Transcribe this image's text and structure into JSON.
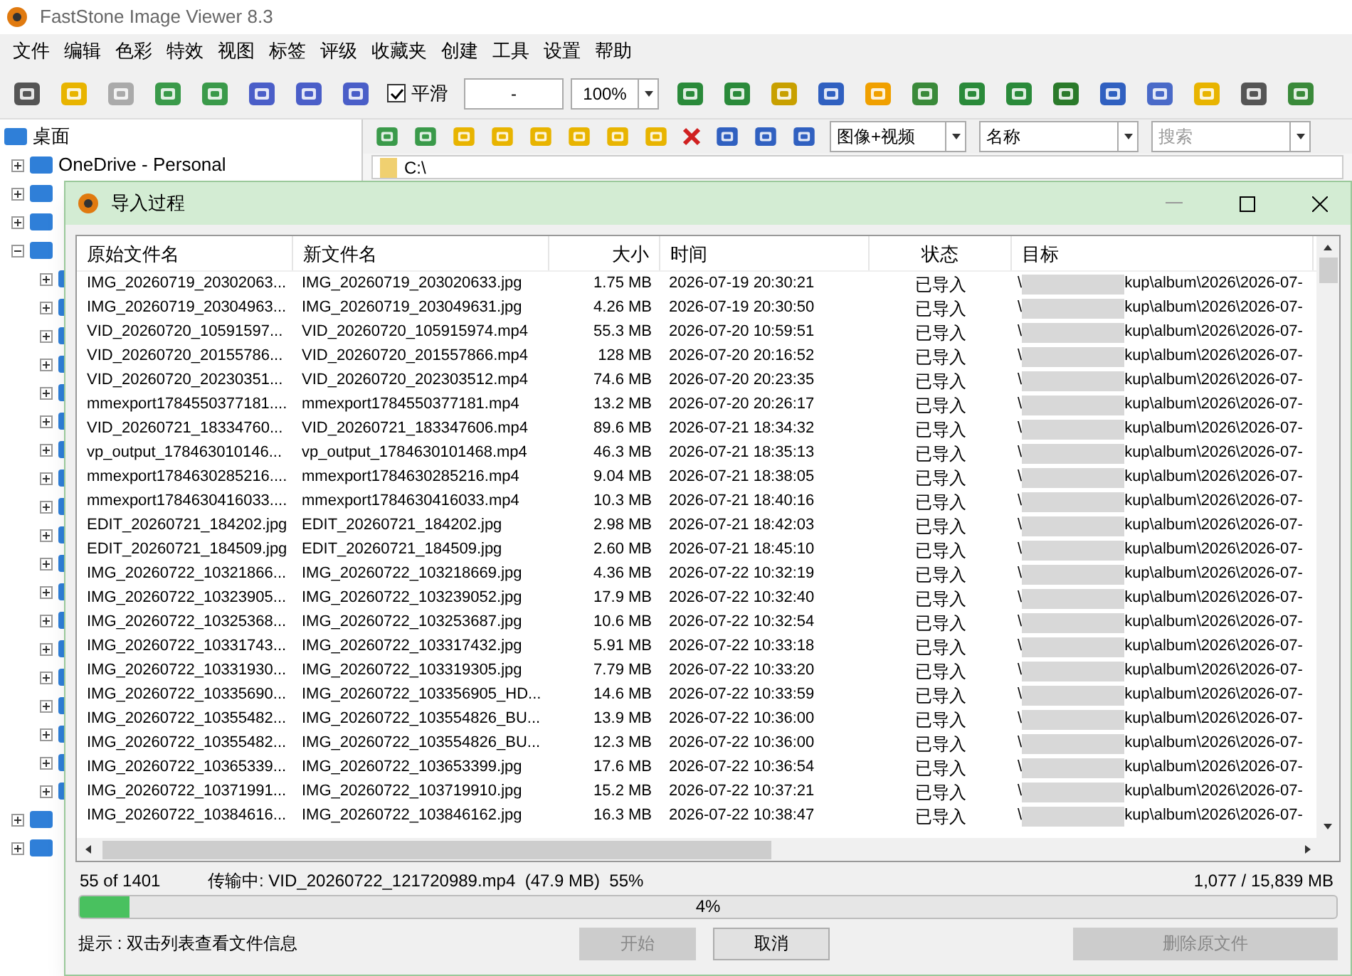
{
  "app_title": "FastStone Image Viewer 8.3",
  "menu": [
    "文件",
    "编辑",
    "色彩",
    "特效",
    "视图",
    "标签",
    "评级",
    "收藏夹",
    "创建",
    "工具",
    "设置",
    "帮助"
  ],
  "toolbar": {
    "smooth": {
      "label": "平滑",
      "checked": true
    },
    "size_field": {
      "value": "-"
    },
    "zoom": {
      "value": "100%"
    }
  },
  "tree": {
    "label": "桌面",
    "children": [
      {
        "label": "OneDrive - Personal",
        "expanded": false
      },
      {
        "expanded": false
      },
      {
        "expanded": false
      },
      {
        "expanded": true,
        "children": [
          {
            "expanded": false
          },
          {
            "expanded": false
          },
          {
            "expanded": false
          },
          {
            "expanded": false
          },
          {
            "expanded": false
          },
          {
            "expanded": false
          },
          {
            "expanded": false
          },
          {
            "expanded": false
          },
          {
            "expanded": false
          },
          {
            "expanded": false
          },
          {
            "expanded": false
          },
          {
            "expanded": false
          },
          {
            "expanded": false
          },
          {
            "expanded": false
          },
          {
            "expanded": false
          },
          {
            "expanded": false
          },
          {
            "expanded": false
          },
          {
            "expanded": false
          },
          {
            "expanded": false
          }
        ]
      },
      {
        "expanded": false
      },
      {
        "expanded": false
      }
    ]
  },
  "browser": {
    "filter": "图像+视频",
    "sort": "名称",
    "search": {
      "placeholder": "搜索"
    },
    "path": "C:\\"
  },
  "dialog": {
    "title": "导入过程",
    "columns": [
      "原始文件名",
      "新文件名",
      "大小",
      "时间",
      "状态",
      "目标"
    ],
    "rows": [
      {
        "original": "IMG_20260719_20302063...",
        "new": "IMG_20260719_203020633.jpg",
        "size": "1.75 MB",
        "time": "2026-07-19 20:30:21",
        "status": "已导入",
        "target_start": "\\",
        "target_end": "kup\\album\\2026\\2026-07-"
      },
      {
        "original": "IMG_20260719_20304963...",
        "new": "IMG_20260719_203049631.jpg",
        "size": "4.26 MB",
        "time": "2026-07-19 20:30:50",
        "status": "已导入",
        "target_start": "\\",
        "target_end": "kup\\album\\2026\\2026-07-"
      },
      {
        "original": "VID_20260720_10591597...",
        "new": "VID_20260720_105915974.mp4",
        "size": "55.3 MB",
        "time": "2026-07-20 10:59:51",
        "status": "已导入",
        "target_start": "\\",
        "target_end": "kup\\album\\2026\\2026-07-"
      },
      {
        "original": "VID_20260720_20155786...",
        "new": "VID_20260720_201557866.mp4",
        "size": "128 MB",
        "time": "2026-07-20 20:16:52",
        "status": "已导入",
        "target_start": "\\",
        "target_end": "kup\\album\\2026\\2026-07-"
      },
      {
        "original": "VID_20260720_20230351...",
        "new": "VID_20260720_202303512.mp4",
        "size": "74.6 MB",
        "time": "2026-07-20 20:23:35",
        "status": "已导入",
        "target_start": "\\",
        "target_end": "kup\\album\\2026\\2026-07-"
      },
      {
        "original": "mmexport1784550377181....",
        "new": "mmexport1784550377181.mp4",
        "size": "13.2 MB",
        "time": "2026-07-20 20:26:17",
        "status": "已导入",
        "target_start": "\\",
        "target_end": "kup\\album\\2026\\2026-07-"
      },
      {
        "original": "VID_20260721_18334760...",
        "new": "VID_20260721_183347606.mp4",
        "size": "89.6 MB",
        "time": "2026-07-21 18:34:32",
        "status": "已导入",
        "target_start": "\\",
        "target_end": "kup\\album\\2026\\2026-07-"
      },
      {
        "original": "vp_output_178463010146...",
        "new": "vp_output_1784630101468.mp4",
        "size": "46.3 MB",
        "time": "2026-07-21 18:35:13",
        "status": "已导入",
        "target_start": "\\",
        "target_end": "kup\\album\\2026\\2026-07-"
      },
      {
        "original": "mmexport1784630285216....",
        "new": "mmexport1784630285216.mp4",
        "size": "9.04 MB",
        "time": "2026-07-21 18:38:05",
        "status": "已导入",
        "target_start": "\\",
        "target_end": "kup\\album\\2026\\2026-07-"
      },
      {
        "original": "mmexport1784630416033....",
        "new": "mmexport1784630416033.mp4",
        "size": "10.3 MB",
        "time": "2026-07-21 18:40:16",
        "status": "已导入",
        "target_start": "\\",
        "target_end": "kup\\album\\2026\\2026-07-"
      },
      {
        "original": "EDIT_20260721_184202.jpg",
        "new": "EDIT_20260721_184202.jpg",
        "size": "2.98 MB",
        "time": "2026-07-21 18:42:03",
        "status": "已导入",
        "target_start": "\\",
        "target_end": "kup\\album\\2026\\2026-07-"
      },
      {
        "original": "EDIT_20260721_184509.jpg",
        "new": "EDIT_20260721_184509.jpg",
        "size": "2.60 MB",
        "time": "2026-07-21 18:45:10",
        "status": "已导入",
        "target_start": "\\",
        "target_end": "kup\\album\\2026\\2026-07-"
      },
      {
        "original": "IMG_20260722_10321866...",
        "new": "IMG_20260722_103218669.jpg",
        "size": "4.36 MB",
        "time": "2026-07-22 10:32:19",
        "status": "已导入",
        "target_start": "\\",
        "target_end": "kup\\album\\2026\\2026-07-"
      },
      {
        "original": "IMG_20260722_10323905...",
        "new": "IMG_20260722_103239052.jpg",
        "size": "17.9 MB",
        "time": "2026-07-22 10:32:40",
        "status": "已导入",
        "target_start": "\\",
        "target_end": "kup\\album\\2026\\2026-07-"
      },
      {
        "original": "IMG_20260722_10325368...",
        "new": "IMG_20260722_103253687.jpg",
        "size": "10.6 MB",
        "time": "2026-07-22 10:32:54",
        "status": "已导入",
        "target_start": "\\",
        "target_end": "kup\\album\\2026\\2026-07-"
      },
      {
        "original": "IMG_20260722_10331743...",
        "new": "IMG_20260722_103317432.jpg",
        "size": "5.91 MB",
        "time": "2026-07-22 10:33:18",
        "status": "已导入",
        "target_start": "\\",
        "target_end": "kup\\album\\2026\\2026-07-"
      },
      {
        "original": "IMG_20260722_10331930...",
        "new": "IMG_20260722_103319305.jpg",
        "size": "7.79 MB",
        "time": "2026-07-22 10:33:20",
        "status": "已导入",
        "target_start": "\\",
        "target_end": "kup\\album\\2026\\2026-07-"
      },
      {
        "original": "IMG_20260722_10335690...",
        "new": "IMG_20260722_103356905_HD...",
        "size": "14.6 MB",
        "time": "2026-07-22 10:33:59",
        "status": "已导入",
        "target_start": "\\",
        "target_end": "kup\\album\\2026\\2026-07-"
      },
      {
        "original": "IMG_20260722_10355482...",
        "new": "IMG_20260722_103554826_BU...",
        "size": "13.9 MB",
        "time": "2026-07-22 10:36:00",
        "status": "已导入",
        "target_start": "\\",
        "target_end": "kup\\album\\2026\\2026-07-"
      },
      {
        "original": "IMG_20260722_10355482...",
        "new": "IMG_20260722_103554826_BU...",
        "size": "12.3 MB",
        "time": "2026-07-22 10:36:00",
        "status": "已导入",
        "target_start": "\\",
        "target_end": "kup\\album\\2026\\2026-07-"
      },
      {
        "original": "IMG_20260722_10365339...",
        "new": "IMG_20260722_103653399.jpg",
        "size": "17.6 MB",
        "time": "2026-07-22 10:36:54",
        "status": "已导入",
        "target_start": "\\",
        "target_end": "kup\\album\\2026\\2026-07-"
      },
      {
        "original": "IMG_20260722_10371991...",
        "new": "IMG_20260722_103719910.jpg",
        "size": "15.2 MB",
        "time": "2026-07-22 10:37:21",
        "status": "已导入",
        "target_start": "\\",
        "target_end": "kup\\album\\2026\\2026-07-"
      },
      {
        "original": "IMG_20260722_10384616...",
        "new": "IMG_20260722_103846162.jpg",
        "size": "16.3 MB",
        "time": "2026-07-22 10:38:47",
        "status": "已导入",
        "target_start": "\\",
        "target_end": "kup\\album\\2026\\2026-07-"
      }
    ],
    "count": "55 of 1401",
    "transfer": "传输中: VID_20260722_121720989.mp4  (47.9 MB)  55%",
    "total": "1,077 / 15,839 MB",
    "progress": {
      "level": 0.04,
      "label": "4%"
    },
    "hint": "提示 : 双击列表查看文件信息",
    "buttons": [
      {
        "label": "开始",
        "disabled": true
      },
      {
        "label": "取消",
        "disabled": false
      },
      {
        "label": "删除原文件",
        "disabled": true
      }
    ]
  }
}
